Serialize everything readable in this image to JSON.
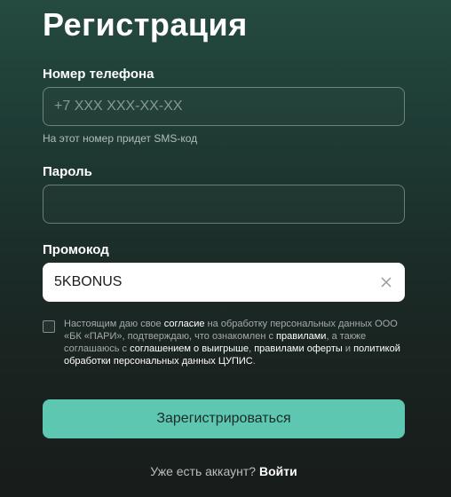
{
  "form": {
    "title": "Регистрация",
    "phone": {
      "label": "Номер телефона",
      "placeholder": "+7 XXX XXX-XX-XX",
      "value": "",
      "hint": "На этот номер придет SMS-код"
    },
    "password": {
      "label": "Пароль",
      "value": ""
    },
    "promo": {
      "label": "Промокод",
      "value": "5KBONUS"
    },
    "consent": {
      "checked": false,
      "t1": "Настоящим даю свое ",
      "l1": "согласие",
      "t2": " на обработку персональных данных ООО «БК «ПАРИ», подтверждаю, что ознакомлен с ",
      "l2": "правилами",
      "t3": ", а также соглашаюсь с ",
      "l3": "соглашением о выигрыше",
      "t4": ", ",
      "l4": "правилами оферты",
      "t5": " и ",
      "l5": "политикой обработки персональных данных ЦУПИС",
      "t6": "."
    },
    "submit_label": "Зарегистрироваться",
    "login": {
      "text": "Уже есть аккаунт? ",
      "link": "Войти"
    }
  },
  "colors": {
    "accent": "#5ec7b1",
    "background_top": "#254a40",
    "background_bottom": "#171c1b"
  }
}
